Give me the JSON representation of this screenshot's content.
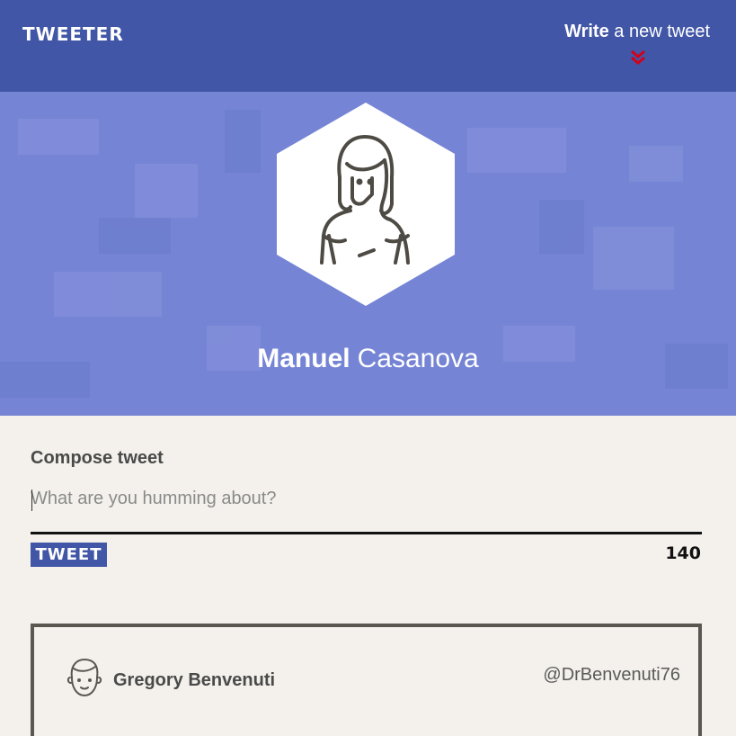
{
  "nav": {
    "brand": "TWEETER",
    "compose_link_bold": "Write",
    "compose_link_rest": "a new tweet",
    "chevron_color": "#d0021b"
  },
  "profile": {
    "first_name": "Manuel",
    "last_name": "Casanova"
  },
  "composer": {
    "title": "Compose tweet",
    "placeholder": "What are you humming about?",
    "button_label": "TWEET",
    "char_count": "140"
  },
  "tweets": [
    {
      "author": "Gregory Benvenuti",
      "handle": "@DrBenvenuti76"
    }
  ],
  "colors": {
    "nav_bg": "#4156a6",
    "hero_bg": "#7584d4",
    "page_bg": "#f4f1ec"
  }
}
